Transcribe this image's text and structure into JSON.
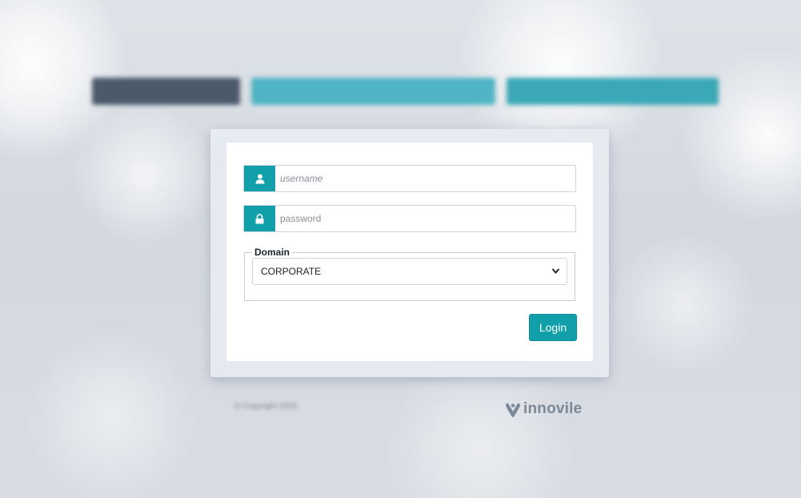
{
  "brand_banner": {
    "redacted": true
  },
  "login_form": {
    "username_placeholder": "username",
    "password_placeholder": "password",
    "domain": {
      "legend": "Domain",
      "selected": "CORPORATE"
    },
    "login_label": "Login"
  },
  "footer": {
    "copyright": "© Copyright 2023",
    "logo_text": "innovile"
  },
  "colors": {
    "accent": "#11a0a9",
    "logo_gray": "#7d8896"
  },
  "icons": {
    "username": "user-icon",
    "password": "lock-icon",
    "dropdown": "chevron-down-icon",
    "logo": "innovile-logo-icon"
  }
}
